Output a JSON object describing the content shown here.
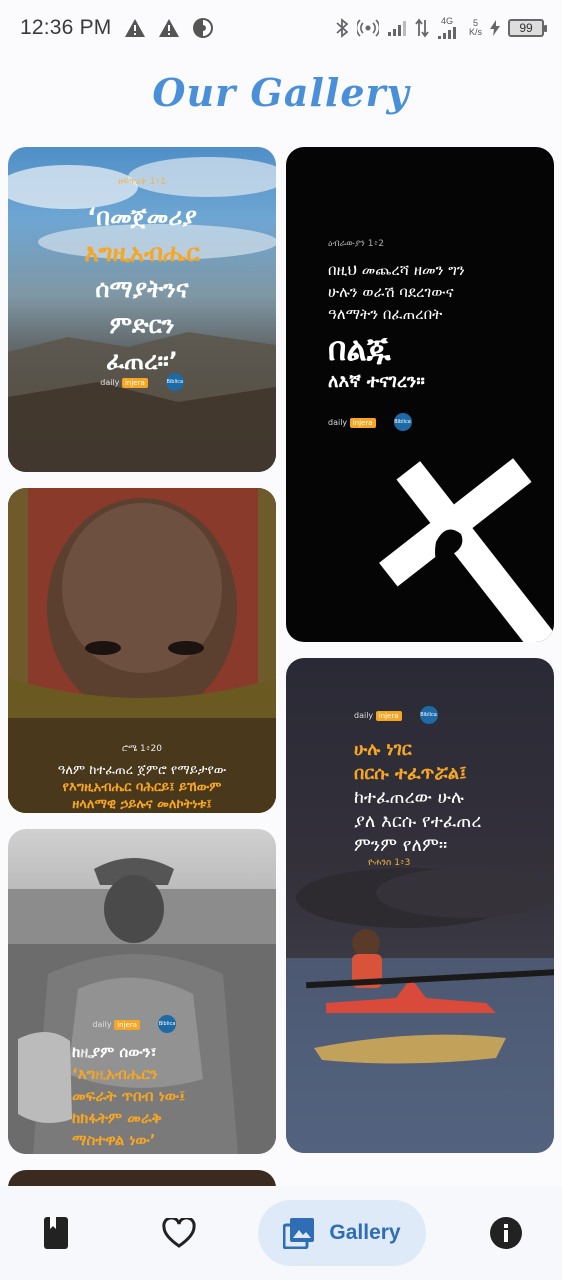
{
  "status": {
    "time": "12:36 PM",
    "net_label": "4G",
    "speed_value": "5",
    "speed_unit": "K/s",
    "battery": "99"
  },
  "page_title": "Our Gallery",
  "cards": [
    {
      "reference": "ዘፍጥረት 1፥1",
      "line1": "‘በመጀመሪያ",
      "line2": "እግዚአብሔር",
      "line3": "ሰማያትንና",
      "line4": "ምድርን",
      "line5": "ፈጠረ።’",
      "brand": "daily",
      "brand_chip": "injera",
      "publisher": "Biblica"
    },
    {
      "reference": "ዕብራውያን 1፥2",
      "line1": "በዚህ መጨረሻ ዘመን ግን",
      "line2": "ሁሉን ወራሽ ባደረገውና",
      "line3": "ዓለማትን በፈጠረበት",
      "big": "በልጁ",
      "line4": "ለእኛ ተናገረን።",
      "brand": "daily",
      "brand_chip": "injera",
      "publisher": "Biblica"
    },
    {
      "reference": "ሮሜ 1፥20",
      "line1": "ዓለም ከተፈጠረ ጀምሮ የማይታየው",
      "line2": "የእግዚአብሔር ባሕርይ፤ ይኸውም",
      "line3": "ዘላለማዊ ኃይሉና መለኮትነቱ፤"
    },
    {
      "brand": "daily",
      "brand_chip": "injera",
      "publisher": "Biblica",
      "line1": "ሁሉ ነገር",
      "line2": "በርሱ ተፈጥሯል፤",
      "line3": "ከተፈጠረው ሁሉ",
      "line4": "ያለ እርሱ የተፈጠረ",
      "line5": "ምንም የለም።",
      "reference": "ዮሐንስ 1፥3"
    },
    {
      "brand": "daily",
      "brand_chip": "injera",
      "publisher": "Biblica",
      "line1": "ከዚያም ሰውን፣",
      "line2": "‘እግዚአብሔርን",
      "line3": "መፍራት ጥበብ ነው፤",
      "line4": "ከክፋትም መራቅ",
      "line5": "ማስተዋል ነው’"
    }
  ],
  "nav": {
    "gallery_label": "Gallery"
  },
  "colors": {
    "accent": "#4a90d9",
    "nav_active_bg": "#dfeaf8",
    "verse_highlight": "#f6a623"
  }
}
